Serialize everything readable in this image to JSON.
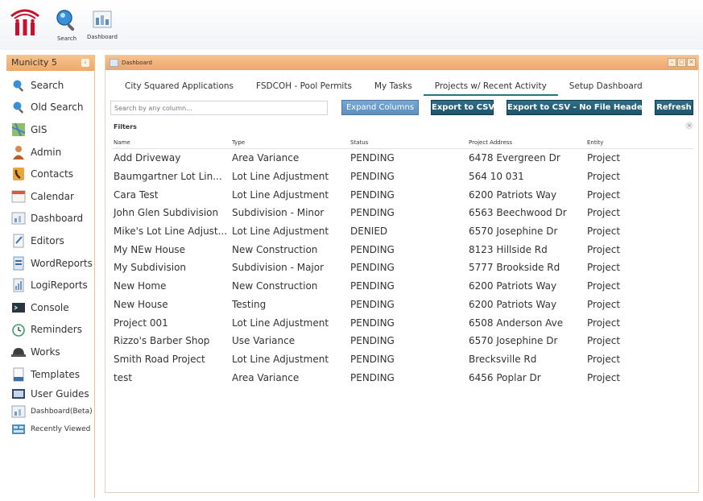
{
  "toolbar": {
    "search_label": "Search",
    "dashboard_label": "Dashboard"
  },
  "sidebar": {
    "title": "Municity 5",
    "items": [
      {
        "label": "Search",
        "icon": "search-icon"
      },
      {
        "label": "Old Search",
        "icon": "search-icon"
      },
      {
        "label": "GIS",
        "icon": "map-icon"
      },
      {
        "label": "Admin",
        "icon": "user-icon"
      },
      {
        "label": "Contacts",
        "icon": "phone-icon"
      },
      {
        "label": "Calendar",
        "icon": "calendar-icon"
      },
      {
        "label": "Dashboard",
        "icon": "dashboard-icon"
      },
      {
        "label": "Editors",
        "icon": "editor-icon"
      },
      {
        "label": "WordReports",
        "icon": "report-icon"
      },
      {
        "label": "LogiReports",
        "icon": "report-icon"
      },
      {
        "label": "Console",
        "icon": "console-icon"
      },
      {
        "label": "Reminders",
        "icon": "clock-icon"
      },
      {
        "label": "Works",
        "icon": "helmet-icon"
      },
      {
        "label": "Templates",
        "icon": "template-icon"
      },
      {
        "label": "User Guides",
        "icon": "book-icon"
      },
      {
        "label": "Dashboard(Beta)",
        "icon": "dashboard-icon"
      },
      {
        "label": "Recently Viewed",
        "icon": "history-icon"
      }
    ]
  },
  "window": {
    "title": "Dashboard",
    "tabs": [
      {
        "label": "City Squared Applications"
      },
      {
        "label": "FSDCOH - Pool Permits"
      },
      {
        "label": "My Tasks"
      },
      {
        "label": "Projects w/ Recent Activity"
      },
      {
        "label": "Setup Dashboard"
      }
    ],
    "active_tab": "Projects w/ Recent Activity",
    "search_placeholder": "Search by any column...",
    "buttons": {
      "expand": "Expand Columns",
      "export_csv": "Export to CSV",
      "export_no_headers": "Export to CSV - No File Headers",
      "refresh": "Refresh"
    },
    "filters_label": "Filters",
    "columns": [
      "Name",
      "Type",
      "Status",
      "Project Address",
      "Entity"
    ],
    "rows": [
      [
        "Add Driveway",
        "Area Variance",
        "PENDING",
        "6478 Evergreen Dr",
        "Project"
      ],
      [
        "Baumgartner Lot Lin...",
        "Lot Line Adjustment",
        "PENDING",
        "564 10 031",
        "Project"
      ],
      [
        "Cara Test",
        "Lot Line Adjustment",
        "PENDING",
        "6200 Patriots Way",
        "Project"
      ],
      [
        "John Glen Subdivision",
        "Subdivision - Minor",
        "PENDING",
        "6563 Beechwood Dr",
        "Project"
      ],
      [
        "Mike's Lot Line Adjust...",
        "Lot Line Adjustment",
        "DENIED",
        "6570 Josephine Dr",
        "Project"
      ],
      [
        "My NEw House",
        "New Construction",
        "PENDING",
        "8123 Hillside Rd",
        "Project"
      ],
      [
        "My Subdivision",
        "Subdivision - Major",
        "PENDING",
        "5777 Brookside Rd",
        "Project"
      ],
      [
        "New Home",
        "New Construction",
        "PENDING",
        "6200 Patriots Way",
        "Project"
      ],
      [
        "New House",
        "Testing",
        "PENDING",
        "6200 Patriots Way",
        "Project"
      ],
      [
        "Project 001",
        "Lot Line Adjustment",
        "PENDING",
        "6508 Anderson Ave",
        "Project"
      ],
      [
        "Rizzo's Barber Shop",
        "Use Variance",
        "PENDING",
        "6570 Josephine Dr",
        "Project"
      ],
      [
        "Smith Road Project",
        "Lot Line Adjustment",
        "PENDING",
        "Brecksville Rd",
        "Project"
      ],
      [
        "test",
        "Area Variance",
        "PENDING",
        "6456 Poplar Dr",
        "Project"
      ]
    ]
  },
  "colors": {
    "accent_orange": "#eea867",
    "button_teal": "#1d546b",
    "active_tab_underline": "#1f7a78"
  }
}
